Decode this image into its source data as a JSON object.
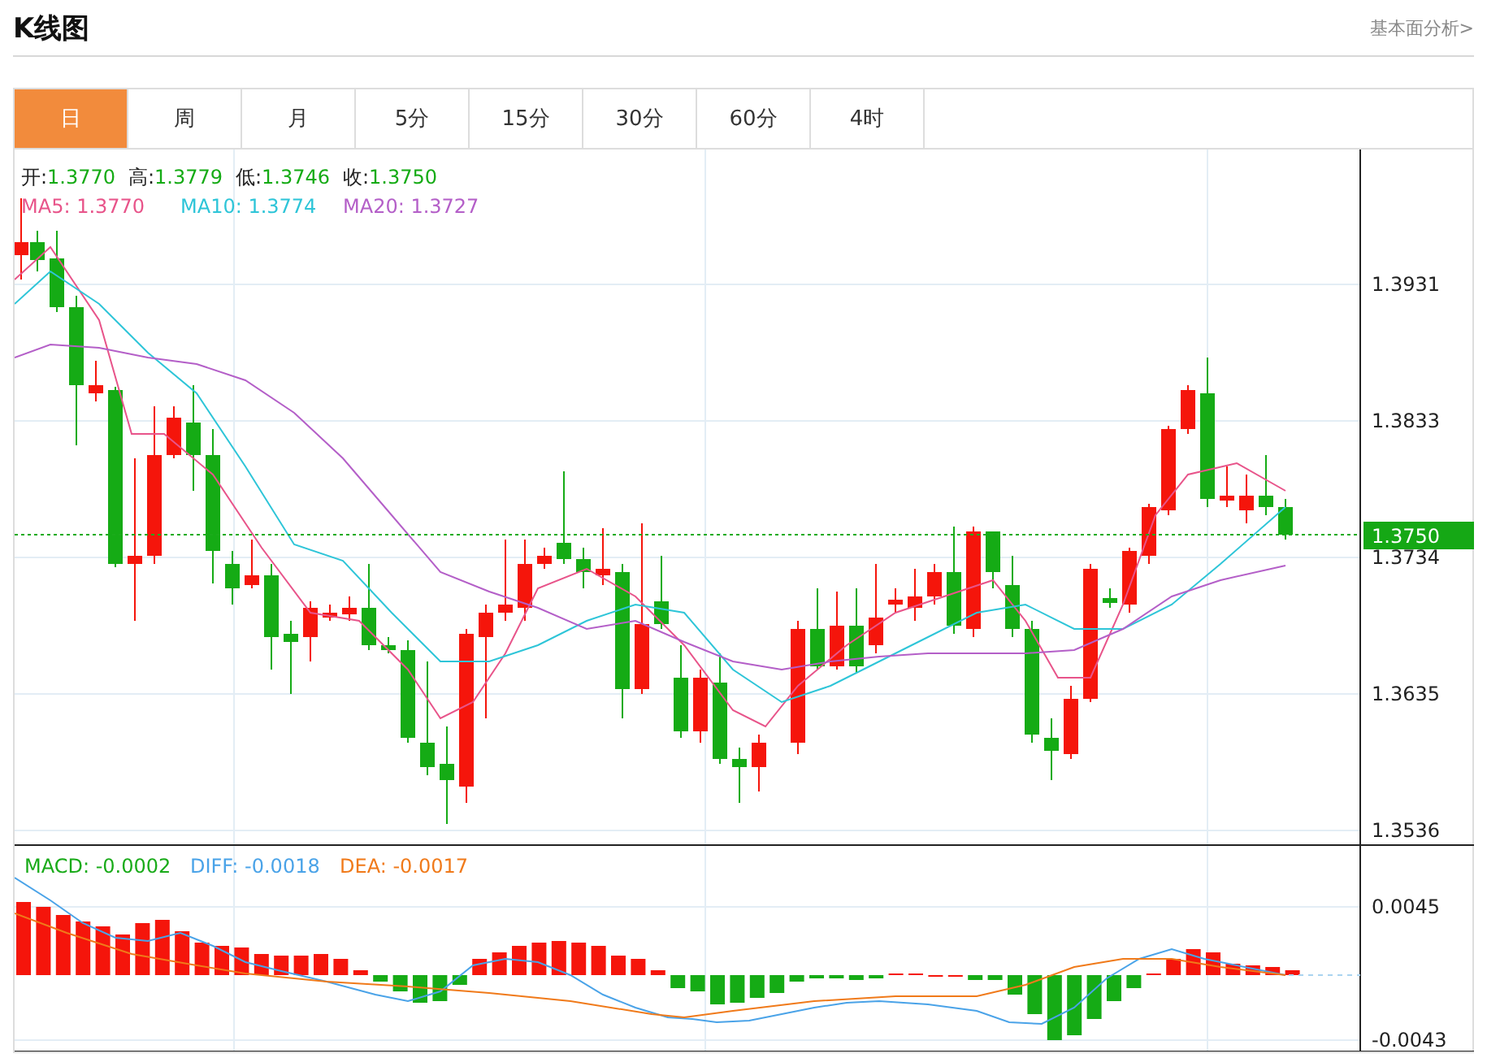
{
  "header": {
    "title": "K线图",
    "link": "基本面分析>"
  },
  "tabs": [
    {
      "label": "日",
      "selected": true
    },
    {
      "label": "周",
      "selected": false
    },
    {
      "label": "月",
      "selected": false
    },
    {
      "label": "5分",
      "selected": false
    },
    {
      "label": "15分",
      "selected": false
    },
    {
      "label": "30分",
      "selected": false
    },
    {
      "label": "60分",
      "selected": false
    },
    {
      "label": "4时",
      "selected": false
    }
  ],
  "price_chart": {
    "ohlc": [
      {
        "label": "开:",
        "value": "1.3770"
      },
      {
        "label": "高:",
        "value": "1.3779"
      },
      {
        "label": "低:",
        "value": "1.3746"
      },
      {
        "label": "收:",
        "value": "1.3750"
      }
    ],
    "moving_averages": [
      {
        "label": "MA5:",
        "value": "1.3770",
        "color": "#e8548a"
      },
      {
        "label": "MA10:",
        "value": "1.3774",
        "color": "#2ec5d8"
      },
      {
        "label": "MA20:",
        "value": "1.3727",
        "color": "#b45fc8"
      }
    ],
    "y_axis_labels": [
      "1.3931",
      "1.3833",
      "1.3734",
      "1.3635",
      "1.3536"
    ],
    "current_price": "1.3750"
  },
  "macd_chart": {
    "legend": [
      {
        "label": "MACD:",
        "value": "-0.0002",
        "color": "#1aab1a"
      },
      {
        "label": "DIFF:",
        "value": "-0.0018",
        "color": "#4aa3e8"
      },
      {
        "label": "DEA:",
        "value": "-0.0017",
        "color": "#f07a1a"
      }
    ],
    "y_axis_labels": [
      "0.0045",
      "-0.0043"
    ]
  }
}
